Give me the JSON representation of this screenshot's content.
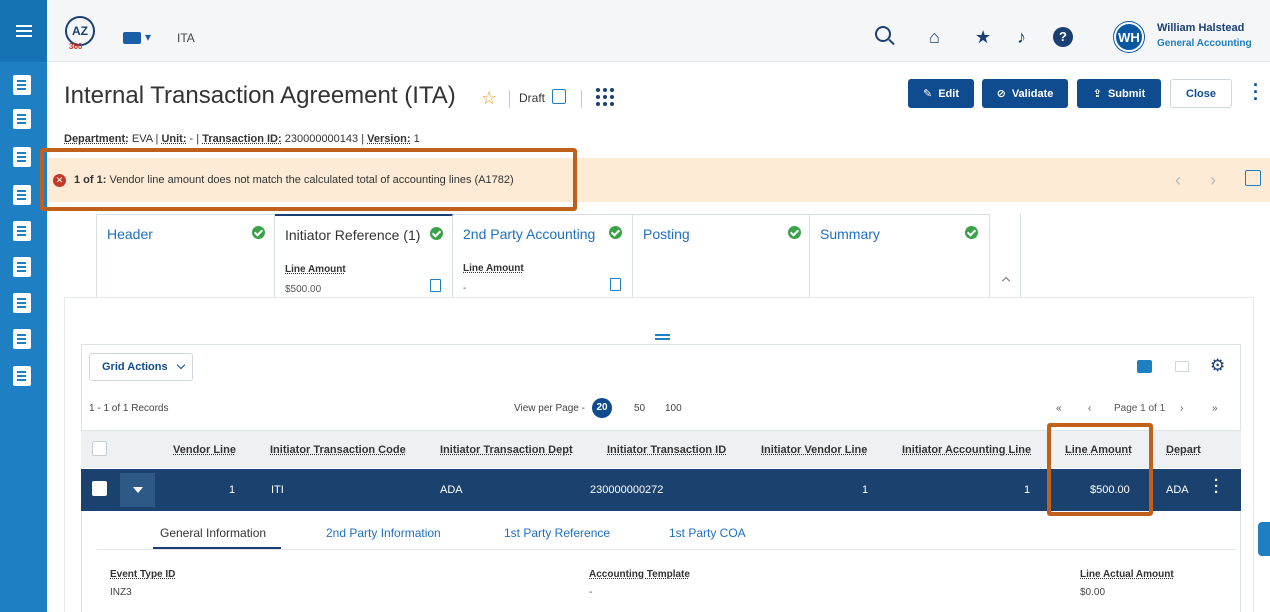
{
  "topbar": {
    "logo_text": "AZ",
    "logo_sub": "360",
    "switcher_label": "▾",
    "breadcrumb": "ITA",
    "user_initials": "WH",
    "user_name": "William Halstead",
    "user_role": "General Accounting"
  },
  "header": {
    "title": "Internal Transaction Agreement (ITA)",
    "status": "Draft",
    "meta": {
      "department_label": "Department:",
      "department_value": "EVA",
      "unit_label": "Unit:",
      "unit_value": "-",
      "txn_label": "Transaction ID:",
      "txn_value": "230000000143",
      "version_label": "Version:",
      "version_value": "1"
    },
    "buttons": {
      "edit": "Edit",
      "validate": "Validate",
      "submit": "Submit",
      "close": "Close"
    }
  },
  "error": {
    "count": "1 of 1:",
    "message": "Vendor line amount does not match the calculated total of accounting lines (A1782)"
  },
  "tabs": [
    {
      "name": "Header",
      "field_label": "",
      "field_value": ""
    },
    {
      "name": "Initiator Reference (1)",
      "field_label": "Line Amount",
      "field_value": "$500.00"
    },
    {
      "name": "2nd Party Accounting",
      "field_label": "Line Amount",
      "field_value": "-"
    },
    {
      "name": "Posting",
      "field_label": "",
      "field_value": ""
    },
    {
      "name": "Summary",
      "field_label": "",
      "field_value": ""
    }
  ],
  "grid": {
    "actions_label": "Grid Actions",
    "records": "1 - 1 of 1 Records",
    "view_per_page": "View per Page -",
    "page_sizes": [
      "20",
      "50",
      "100"
    ],
    "pager_first": "«",
    "pager_prev": "‹",
    "page_label": "Page 1 of 1",
    "pager_next": "›",
    "pager_last": "»",
    "columns": [
      "Vendor Line",
      "Initiator Transaction Code",
      "Initiator Transaction Dept",
      "Initiator Transaction ID",
      "Initiator Vendor Line",
      "Initiator Accounting Line",
      "Line Amount",
      "Depart"
    ],
    "row": [
      "1",
      "ITI",
      "ADA",
      "230000000272",
      "1",
      "1",
      "$500.00",
      "ADA"
    ]
  },
  "detail": {
    "tabs": [
      "General Information",
      "2nd Party Information",
      "1st Party Reference",
      "1st Party COA"
    ],
    "fields": [
      {
        "label": "Event Type ID",
        "value": "INZ3"
      },
      {
        "label": "Accounting Template",
        "value": "-"
      },
      {
        "label": "Line Actual Amount",
        "value": "$0.00"
      }
    ]
  },
  "colors": {
    "rail": "#1f7fc3",
    "primary_button": "#0f4c8f",
    "selected_row": "#1b426e",
    "error_banner": "#fdebd5",
    "highlight_box": "#c0601a",
    "success": "#3aa24a"
  }
}
